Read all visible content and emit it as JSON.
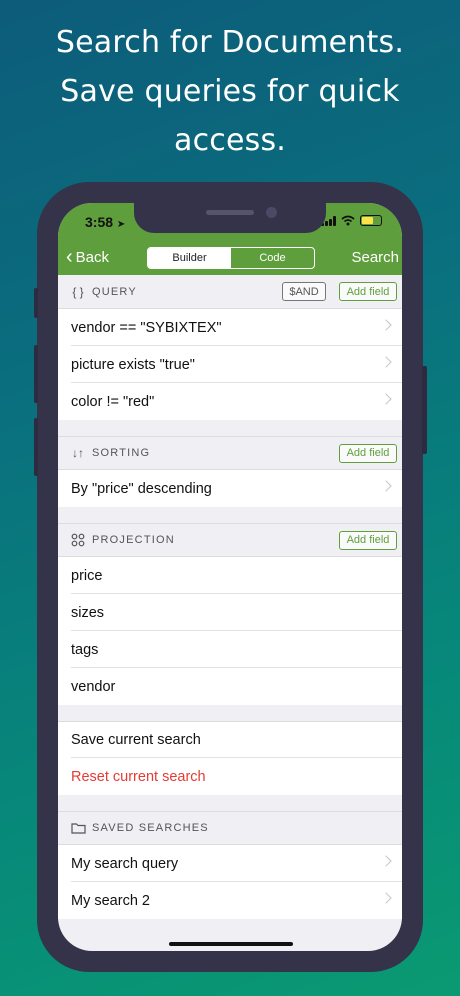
{
  "headline": [
    "Search for Documents.",
    "Save queries for quick",
    "access."
  ],
  "status": {
    "time": "3:58"
  },
  "nav": {
    "back": "Back",
    "search": "Search",
    "segments": [
      "Builder",
      "Code"
    ],
    "selected": "Builder"
  },
  "query": {
    "title": "QUERY",
    "and_label": "$AND",
    "add_field": "Add field",
    "rows": [
      "vendor == \"SYBIXTEX\"",
      "picture exists \"true\"",
      "color != \"red\""
    ]
  },
  "sorting": {
    "title": "SORTING",
    "add_field": "Add field",
    "rows": [
      "By \"price\" descending"
    ]
  },
  "projection": {
    "title": "PROJECTION",
    "add_field": "Add field",
    "rows": [
      "price",
      "sizes",
      "tags",
      "vendor"
    ]
  },
  "actions": {
    "save": "Save current search",
    "reset": "Reset current search"
  },
  "saved": {
    "title": "SAVED SEARCHES",
    "rows": [
      "My search query",
      "My search 2"
    ]
  },
  "colors": {
    "accent": "#5e9e3c",
    "destructive": "#e53b35",
    "background": "#efeff4"
  }
}
